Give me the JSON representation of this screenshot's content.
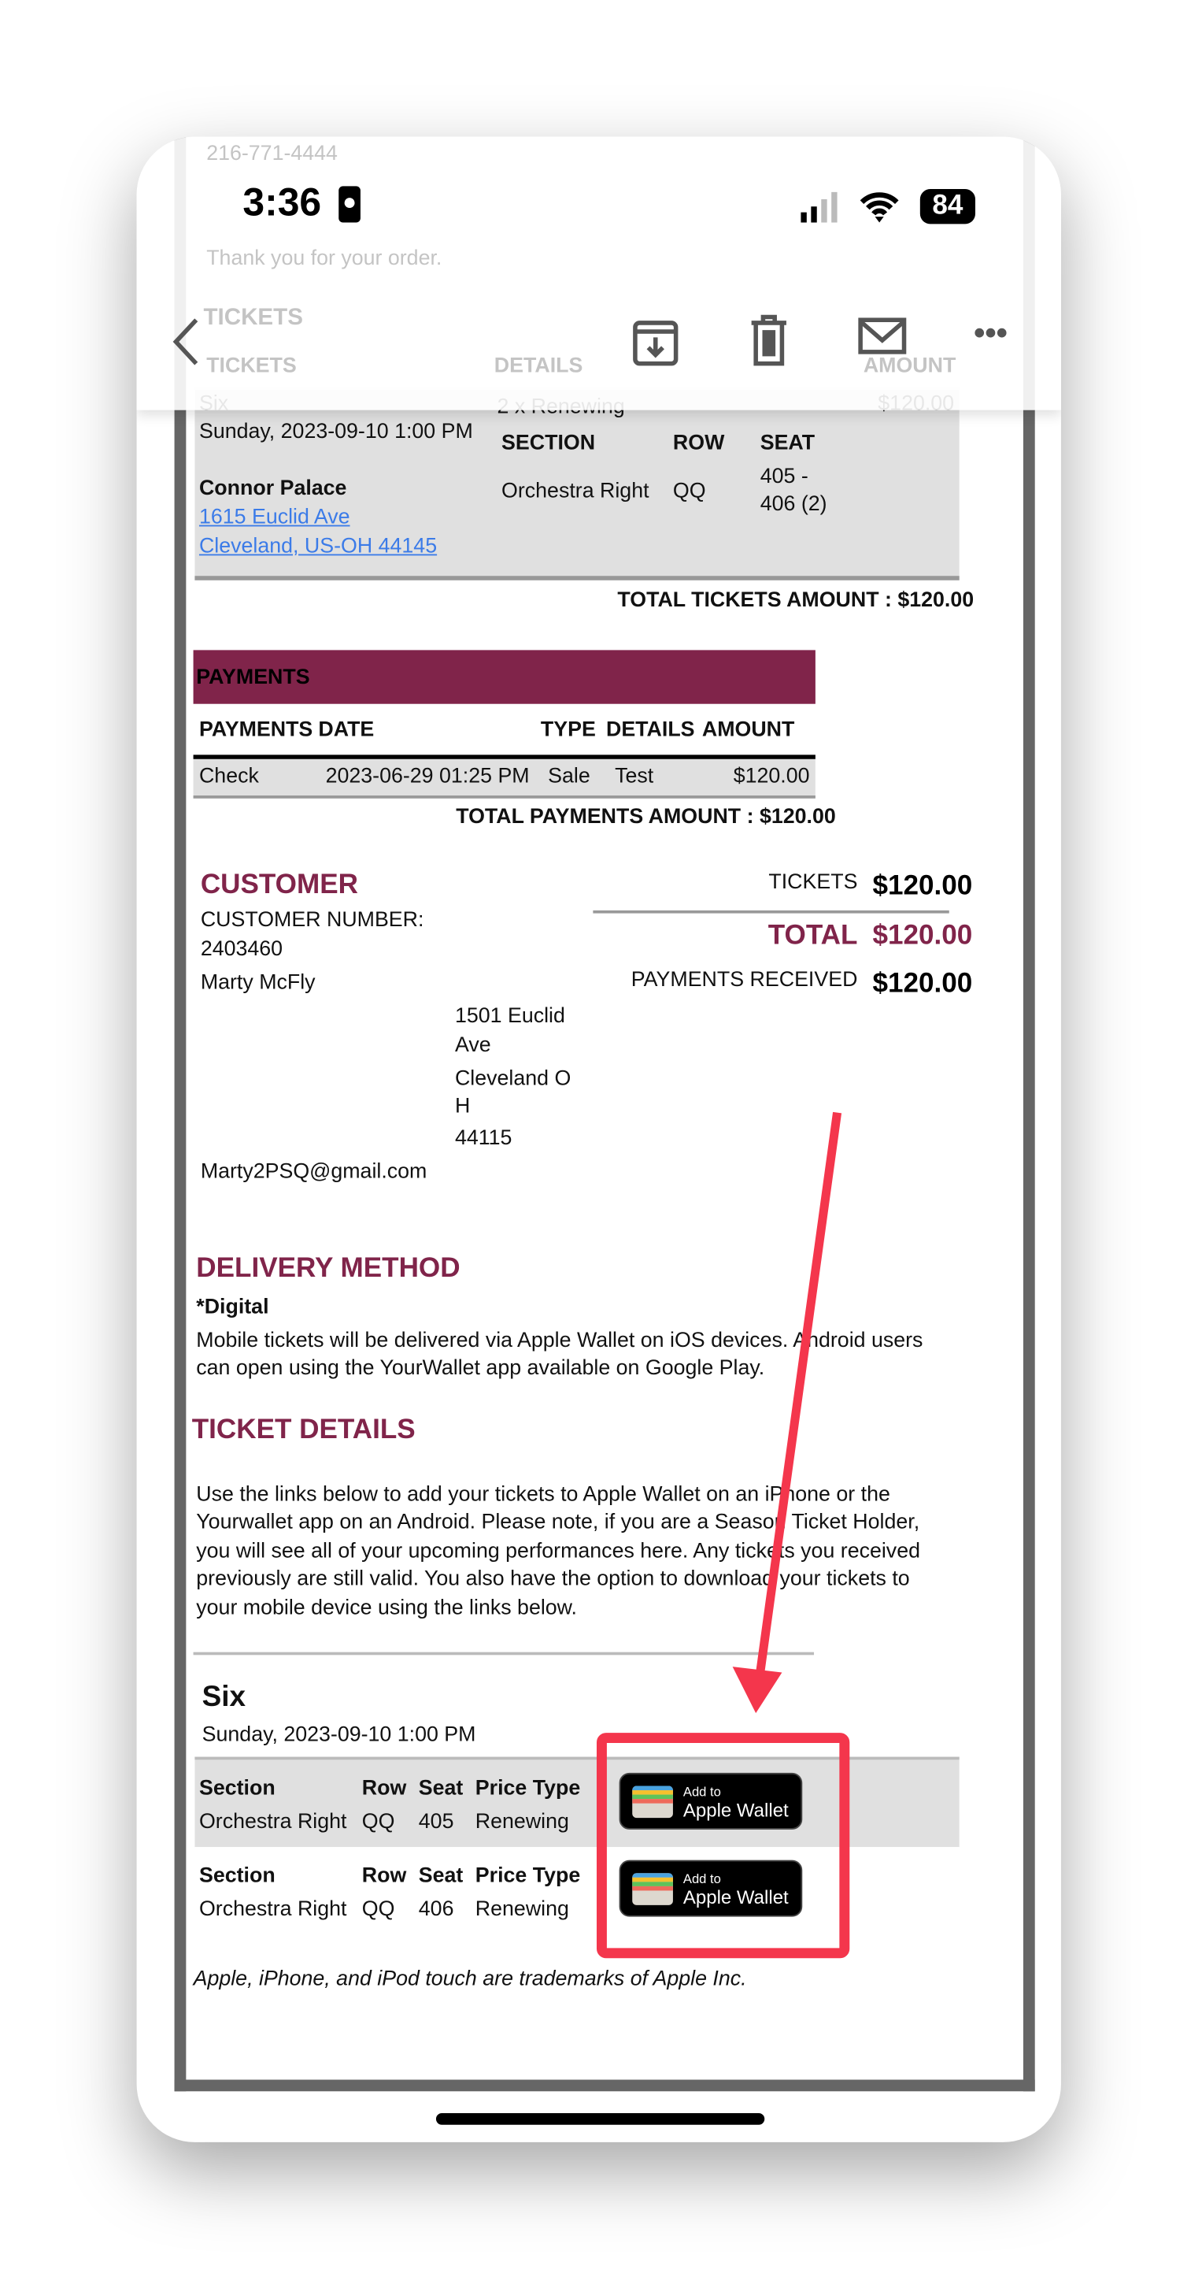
{
  "status_bar": {
    "time": "3:36",
    "battery": "84"
  },
  "nav": {
    "back": "back",
    "icons": [
      "archive-icon",
      "trash-icon",
      "mail-icon",
      "more-icon"
    ]
  },
  "faded": {
    "phone": "216-771-4444",
    "thanks": "Thank you for your order.",
    "tickets_title": "TICKETS",
    "col_tickets": "TICKETS",
    "col_details": "DETAILS",
    "col_amount": "AMOUNT"
  },
  "tickets": {
    "show": "Six",
    "date": "Sunday, 2023-09-10 1:00 PM",
    "details": "2 x Renewing",
    "amount": "$120.00",
    "section_h": "SECTION",
    "row_h": "ROW",
    "seat_h": "SEAT",
    "section": "Orchestra Right",
    "row": "QQ",
    "seat1": "405 -",
    "seat2": "406 (2)",
    "venue": "Connor Palace",
    "addr1": "1615 Euclid Ave",
    "addr2": "Cleveland, US-OH 44145",
    "total": "TOTAL TICKETS AMOUNT : $120.00"
  },
  "payments": {
    "title": "PAYMENTS",
    "headers": [
      "PAYMENTS",
      "DATE",
      "TYPE",
      "DETAILS",
      "AMOUNT"
    ],
    "row": [
      "Check",
      "2023-06-29 01:25 PM",
      "Sale",
      "Test",
      "$120.00"
    ],
    "total": "TOTAL PAYMENTS AMOUNT : $120.00"
  },
  "customer": {
    "title": "CUSTOMER",
    "number_label": "CUSTOMER NUMBER:",
    "number": "2403460",
    "name": "Marty McFly",
    "addr": [
      "1501 Euclid",
      "Ave",
      "Cleveland O",
      "H",
      "44115"
    ],
    "email": "Marty2PSQ@gmail.com"
  },
  "summary": {
    "tickets_label": "TICKETS",
    "tickets": "$120.00",
    "total_label": "TOTAL",
    "total": "$120.00",
    "received_label": "PAYMENTS RECEIVED",
    "received": "$120.00"
  },
  "delivery": {
    "title": "DELIVERY METHOD",
    "method": "*Digital",
    "text1": "Mobile tickets will be delivered via Apple Wallet on iOS devices. Android users",
    "text2": "can open using the YourWallet app available on Google Play."
  },
  "ticket_details": {
    "title": "TICKET DETAILS",
    "lines": [
      "Use the links below to add your tickets to Apple Wallet on an iPhone or the",
      "Yourwallet app on an Android. Please note, if you are a Season Ticket Holder,",
      "you will see all of your upcoming performances here. Any tickets you received",
      "previously are still valid. You also have the option to download your tickets to",
      "your mobile device using the links below."
    ],
    "show": "Six",
    "date": "Sunday, 2023-09-10 1:00 PM",
    "headers": [
      "Section",
      "Row",
      "Seat",
      "Price Type"
    ],
    "rows": [
      [
        "Orchestra Right",
        "QQ",
        "405",
        "Renewing"
      ],
      [
        "Orchestra Right",
        "QQ",
        "406",
        "Renewing"
      ]
    ],
    "wallet_small": "Add to",
    "wallet_large": "Apple Wallet"
  },
  "trademark": "Apple, iPhone, and iPod touch are trademarks of Apple Inc.",
  "colors": {
    "accent": "#80244a",
    "annotation": "#f4364c",
    "link": "#3b7be8"
  }
}
